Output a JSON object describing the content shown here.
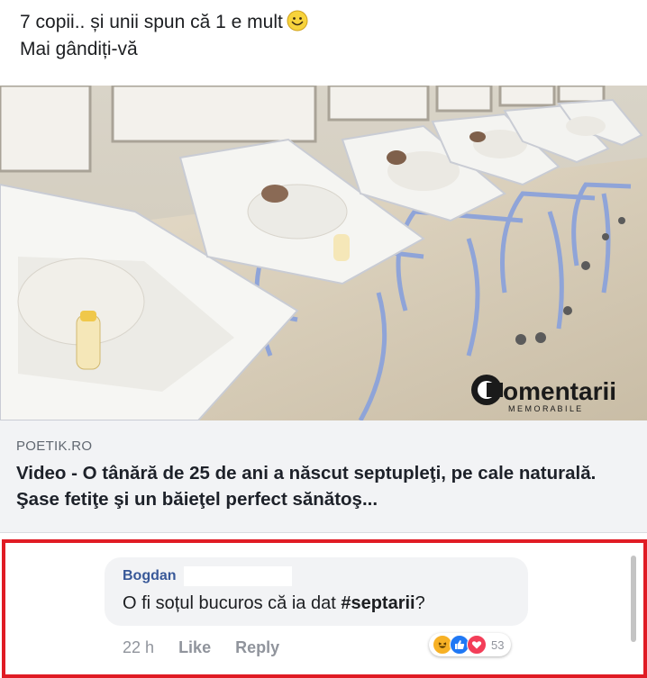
{
  "post": {
    "line1": "7 copii.. și unii spun că 1 e mult",
    "line2": "Mai gândiți-vă",
    "emoji": "smile-emoji"
  },
  "watermark": {
    "brand": "omentarii",
    "sub": "M E M O R A B I L E"
  },
  "link": {
    "domain": "POETIK.RO",
    "title": "Video - O tânără de 25 de ani a născut septupleţi, pe cale naturală. Şase fetiţe şi un băieţel perfect sănătoş..."
  },
  "comment": {
    "author": "Bogdan",
    "text_before": "O fi soțul bucuros că ia dat ",
    "hashtag": "#septarii",
    "text_after": "?",
    "time": "22 h",
    "like_label": "Like",
    "reply_label": "Reply",
    "reaction_count": "53",
    "reactions": [
      "haha-icon",
      "like-icon",
      "love-icon"
    ]
  },
  "colors": {
    "highlight_border": "#e01b24",
    "author_link": "#385898",
    "meta_gray": "#90949c"
  }
}
